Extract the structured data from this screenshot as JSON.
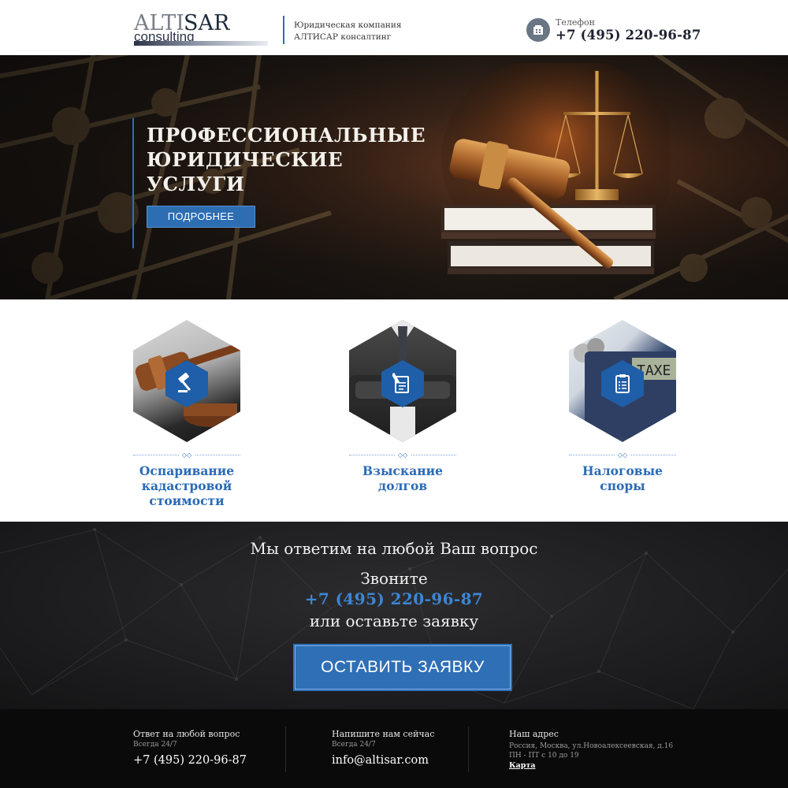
{
  "header": {
    "logo": {
      "alti": "ALTI",
      "sar": "SAR",
      "consulting": "consulting"
    },
    "company_line1": "Юридическая компания",
    "company_line2": "АЛТИСАР консалтинг",
    "phone_label": "Телефон",
    "phone_number": "+7 (495) 220-96-87",
    "phone_icon": "phone-icon"
  },
  "hero": {
    "title_line1": "ПРОФЕССИОНАЛЬНЫЕ",
    "title_line2": "ЮРИДИЧЕСКИЕ",
    "title_line3": "УСЛУГИ",
    "button_label": "ПОДРОБНЕЕ"
  },
  "services": [
    {
      "icon": "gavel-icon",
      "title_line1": "Оспаривание",
      "title_line2": "кадастровой",
      "title_line3": "стоимости"
    },
    {
      "icon": "document-pen-icon",
      "title_line1": "Взыскание",
      "title_line2": "долгов",
      "title_line3": ""
    },
    {
      "icon": "clipboard-icon",
      "title_line1": "Налоговые",
      "title_line2": "споры",
      "title_line3": ""
    }
  ],
  "cta": {
    "headline": "Мы ответим на любой Ваш вопрос",
    "call": "Звоните",
    "phone": "+7 (495) 220-96-87",
    "or": "или оставьте заявку",
    "button_label": "ОСТАВИТЬ ЗАЯВКУ"
  },
  "footer": {
    "col1": {
      "title": "Ответ на любой вопрос",
      "sub": "Всегда 24/7",
      "value": "+7 (495) 220-96-87"
    },
    "col2": {
      "title": "Напишите нам сейчас",
      "sub": "Всегда 24/7",
      "value": "info@altisar.com"
    },
    "col3": {
      "title": "Наш адрес",
      "address": "Россия, Москва, ул.Новоалексеевская, д.16",
      "hours": "ПН - ПТ с 10 до 19",
      "map_link": "Карта"
    }
  },
  "colors": {
    "accent": "#2f6fb6",
    "service_title": "#2a6bb5",
    "cta_phone": "#3b86d6",
    "footer_bg": "#0a0a0a"
  }
}
